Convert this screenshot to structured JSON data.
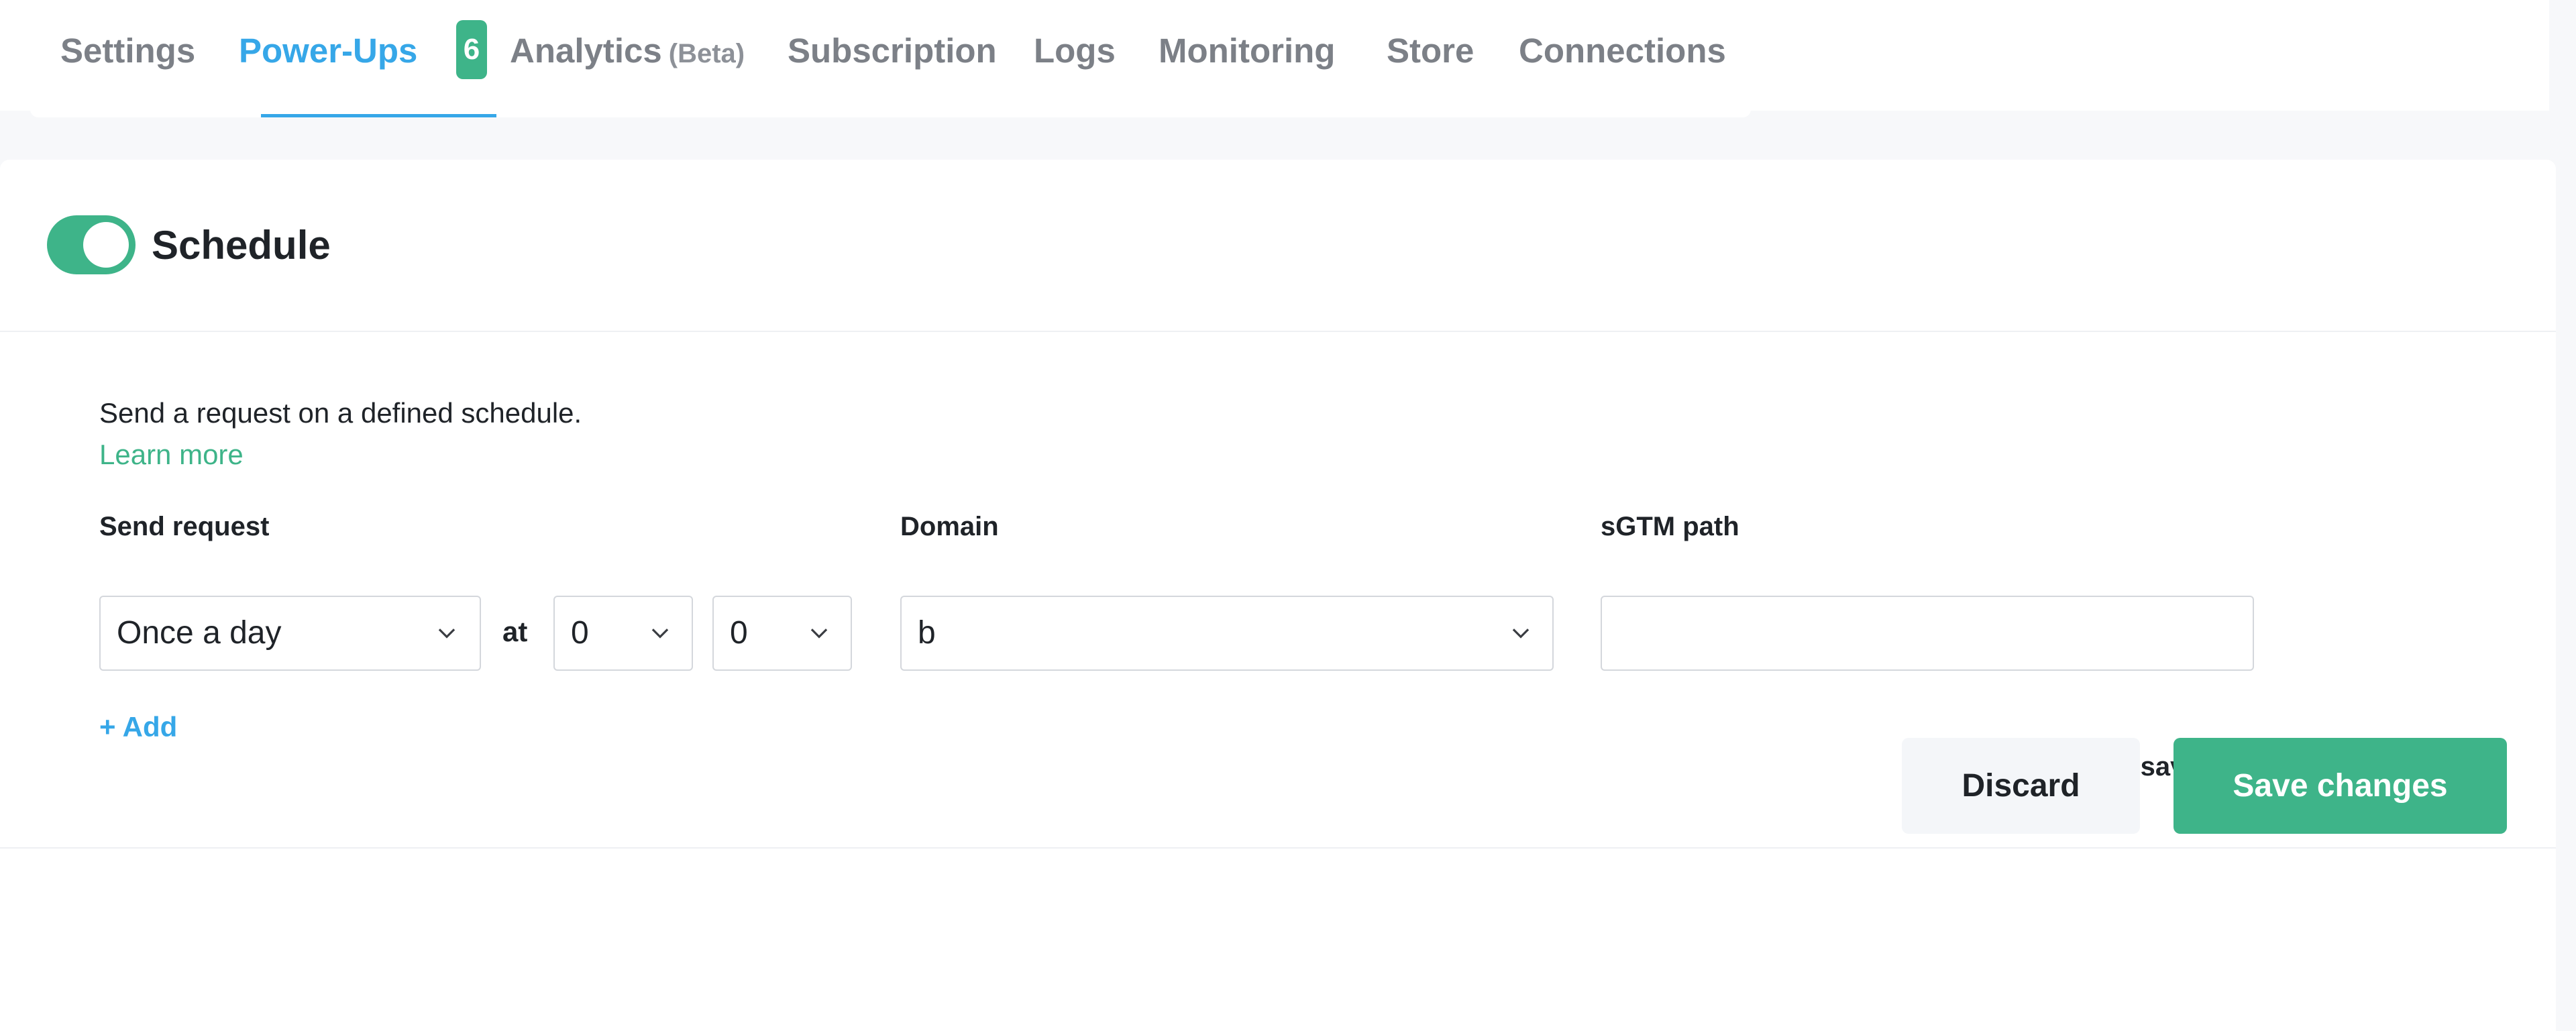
{
  "tabs": [
    {
      "label": "Settings"
    },
    {
      "label": "Power-Ups",
      "badge": "6",
      "active": true
    },
    {
      "label": "Analytics",
      "suffix": "(Beta)"
    },
    {
      "label": "Subscription"
    },
    {
      "label": "Logs"
    },
    {
      "label": "Monitoring"
    },
    {
      "label": "Store"
    },
    {
      "label": "Connections"
    }
  ],
  "card": {
    "title": "Schedule",
    "enabled": true,
    "description": "Send a request on a defined schedule.",
    "learn_more": "Learn more"
  },
  "form": {
    "send_request": {
      "label": "Send request",
      "value": "Once a day"
    },
    "at_label": "at",
    "hour": {
      "value": "0"
    },
    "minute": {
      "value": "0"
    },
    "domain": {
      "label": "Domain",
      "value": "b"
    },
    "path": {
      "label": "sGTM path",
      "value": ""
    },
    "add_label": "+ Add"
  },
  "footer": {
    "reminder": "Don’t forget to save",
    "discard": "Discard",
    "save": "Save changes"
  },
  "colors": {
    "accent_green": "#3eb489",
    "accent_blue": "#36a7e8",
    "arrow_orange": "#f07a3c"
  },
  "icons": {
    "select_caret": "chevron-down-icon",
    "reminder_arrow": "curved-arrow-icon"
  }
}
